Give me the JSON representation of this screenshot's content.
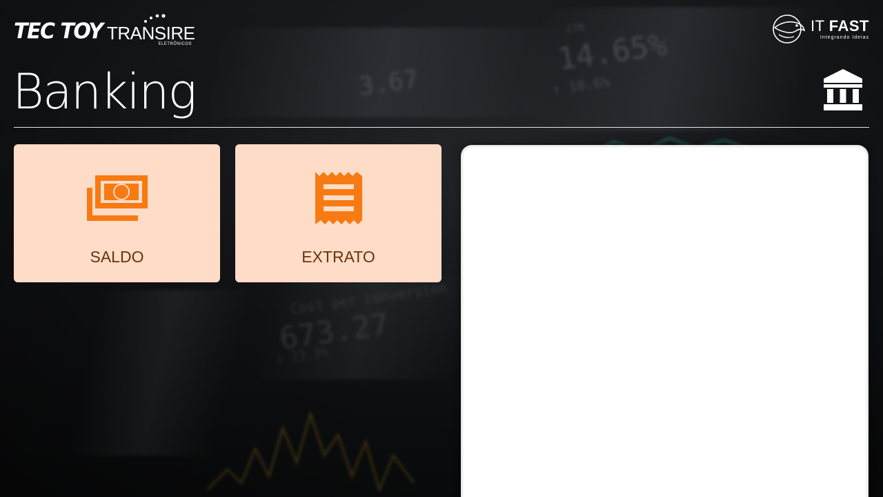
{
  "brand": {
    "tectoy": "TEC TOY",
    "transire": "TRANSIRE",
    "transire_sub": "ELETRÔNICOS",
    "itfast_it": "IT",
    "itfast_fast": "FAST",
    "itfast_tagline": "Integrando Ideias"
  },
  "page": {
    "title": "Banking",
    "icon": "bank-icon"
  },
  "tiles": [
    {
      "label": "SALDO",
      "icon": "money-bills-icon"
    },
    {
      "label": "EXTRATO",
      "icon": "receipt-icon"
    }
  ],
  "colors": {
    "tile_bg": "#ffdcc8",
    "tile_icon": "#f77a12",
    "tile_label": "#6b3208",
    "panel_bg": "#ffffff",
    "header_text": "#ffffff"
  }
}
